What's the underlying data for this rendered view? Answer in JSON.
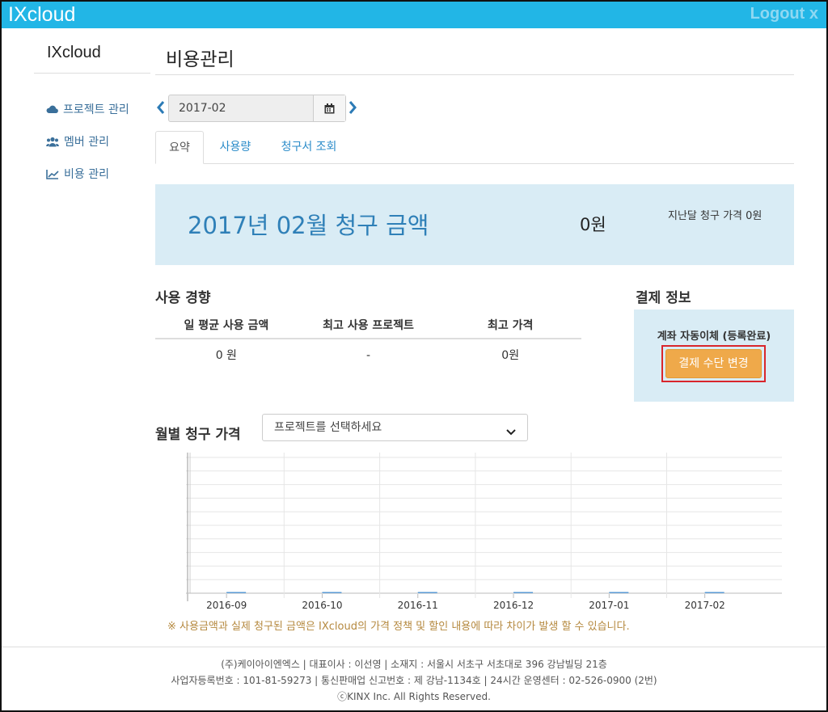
{
  "header": {
    "brand": "IXcloud",
    "logout": "Logout x"
  },
  "sidebar": {
    "title": "IXcloud",
    "items": [
      {
        "label": "프로젝트 관리",
        "icon": "cloud-icon"
      },
      {
        "label": "멤버 관리",
        "icon": "users-icon"
      },
      {
        "label": "비용 관리",
        "icon": "line-chart-icon"
      }
    ]
  },
  "main": {
    "title": "비용관리",
    "month": "2017-02",
    "tabs": [
      {
        "label": "요약",
        "active": true
      },
      {
        "label": "사용량",
        "active": false
      },
      {
        "label": "청구서 조회",
        "active": false
      }
    ],
    "summary": {
      "title": "2017년 02월 청구 금액",
      "amount": "0원",
      "previous": "지난달 청구 가격 0원"
    },
    "usage": {
      "title": "사용 경향",
      "headers": [
        "일 평균 사용 금액",
        "최고 사용 프로젝트",
        "최고 가격"
      ],
      "row": [
        "0 원",
        "-",
        "0원"
      ]
    },
    "payment": {
      "title": "결제 정보",
      "status": "계좌 자동이체 (등록완료)",
      "button": "결제 수단 변경"
    },
    "monthly": {
      "title": "월별 청구 가격",
      "select_placeholder": "프로젝트를 선택하세요"
    },
    "note": "※ 사용금액과 실제 청구된 금액은 IXcloud의 가격 정책 및 할인 내용에 따라 차이가 발생 할 수 있습니다."
  },
  "chart_data": {
    "type": "bar",
    "categories": [
      "2016-09",
      "2016-10",
      "2016-11",
      "2016-12",
      "2017-01",
      "2017-02"
    ],
    "values": [
      0,
      0,
      0,
      0,
      0,
      0
    ],
    "title": "",
    "xlabel": "",
    "ylabel": "",
    "grid": true,
    "color": "#5b9bd5"
  },
  "footer": {
    "lines": [
      "(주)케이아이엔엑스 | 대표이사 : 이선영 | 소재지 : 서울시 서초구 서초대로 396 강남빌딩 21층",
      "사업자등록번호 : 101-81-59273 | 통신판매업 신고번호 : 제 강남-1134호 | 24시간 운영센터 : 02-526-0900 (2번)",
      "ⓒKINX Inc. All Rights Reserved."
    ]
  },
  "colors": {
    "topbar": "#22b6e6",
    "accent": "#2f80b8",
    "button": "#efa94a",
    "highlight": "#d9262c"
  }
}
